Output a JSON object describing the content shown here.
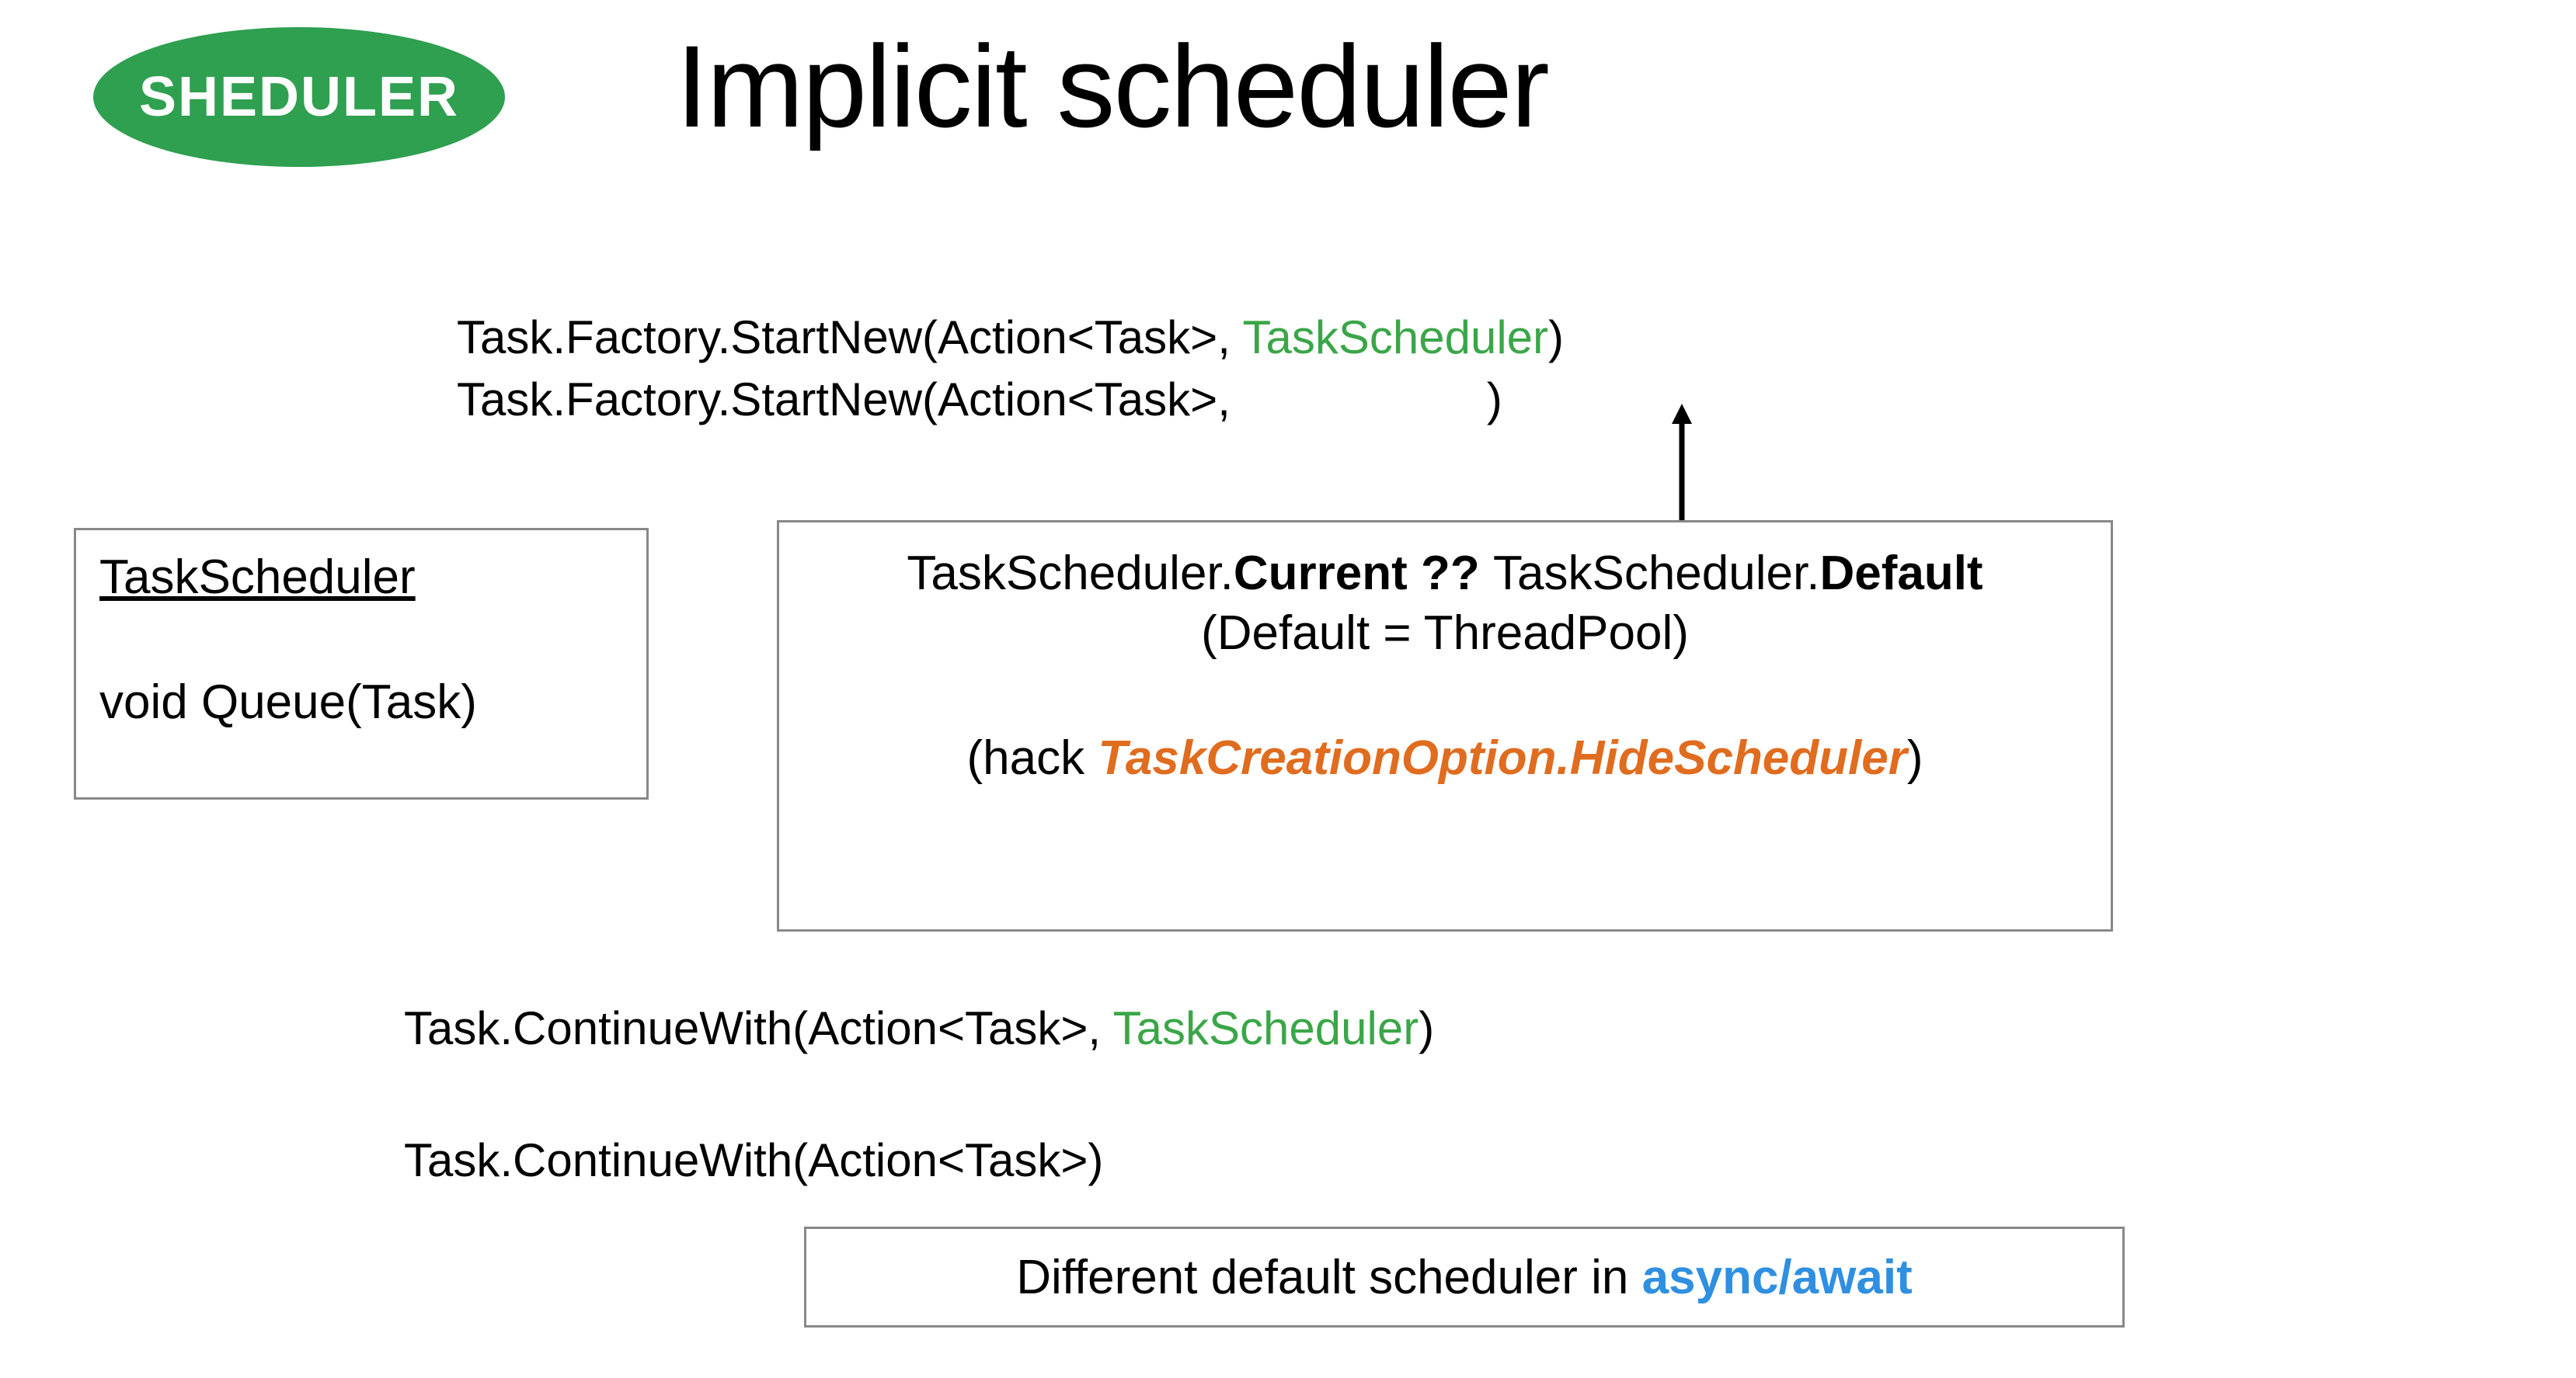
{
  "badge": {
    "label": "SHEDULER"
  },
  "title": "Implicit scheduler",
  "code": {
    "line1_prefix": "Task.Factory.StartNew(Action<Task>, ",
    "line1_green": "TaskScheduler",
    "line1_suffix": ")",
    "line2_prefix": "Task.Factory.StartNew(Action<Task>,",
    "line2_suffix": ")",
    "line3_prefix": "Task.ContinueWith(Action<Task>, ",
    "line3_green": "TaskScheduler",
    "line3_suffix": ")",
    "line4": "Task.ContinueWith(Action<Task>)"
  },
  "box_left": {
    "title": "TaskScheduler",
    "method": "void Queue(Task)"
  },
  "box_mid": {
    "line1_a": "TaskScheduler.",
    "line1_b": "Current ?? ",
    "line1_c": "TaskScheduler.",
    "line1_d": "Default",
    "line2": "(Default = ThreadPool)",
    "line3_a": "(hack ",
    "line3_b": "TaskCreationOption.HideScheduler",
    "line3_c": ")"
  },
  "box_bottom": {
    "text_a": "Different default scheduler in ",
    "text_b": "async/await"
  },
  "colors": {
    "badge_bg": "#2f9f50",
    "green": "#3aa648",
    "orange": "#e06c1f",
    "blue": "#2f8fe0"
  }
}
